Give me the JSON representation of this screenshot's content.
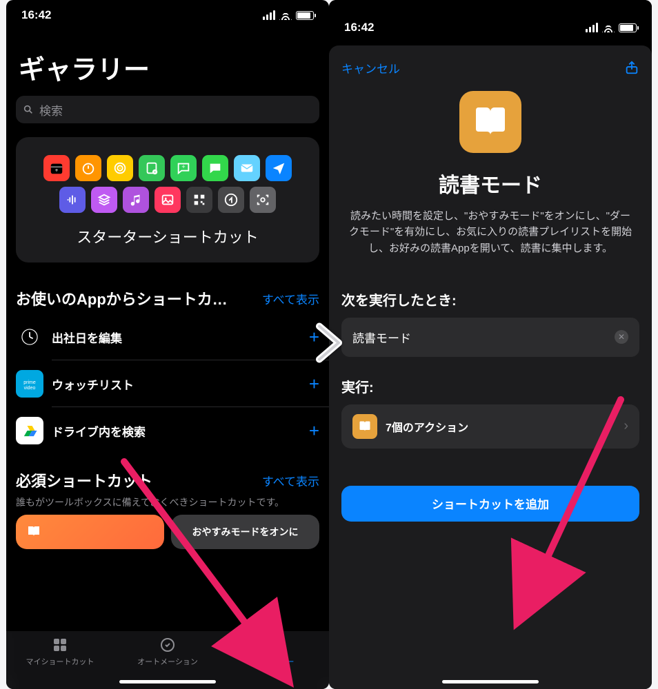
{
  "status": {
    "time": "16:42"
  },
  "left": {
    "title": "ギャラリー",
    "search_placeholder": "検索",
    "starter_card": {
      "title": "スターターショートカット",
      "tiles": [
        {
          "bg": "#ff3b30",
          "icon": "calendar-plus"
        },
        {
          "bg": "#ff9500",
          "icon": "timer"
        },
        {
          "bg": "#ffcc00",
          "icon": "airplay"
        },
        {
          "bg": "#34c759",
          "icon": "note-plus"
        },
        {
          "bg": "#30d158",
          "icon": "chat-plus"
        },
        {
          "bg": "#32d74b",
          "icon": "message"
        },
        {
          "bg": "#64d2ff",
          "icon": "mail"
        },
        {
          "bg": "#0a84ff",
          "icon": "send"
        },
        {
          "bg": "#5e5ce6",
          "icon": "waveform"
        },
        {
          "bg": "#bf5af2",
          "icon": "layers"
        },
        {
          "bg": "#af52de",
          "icon": "music-note"
        },
        {
          "bg": "#ff375f",
          "icon": "photo"
        },
        {
          "bg": "#3a3a3c",
          "icon": "qr"
        },
        {
          "bg": "#48484a",
          "icon": "share-arrow"
        },
        {
          "bg": "#636366",
          "icon": "scan"
        }
      ]
    },
    "section_apps": {
      "title": "お使いのAppからショートカ…",
      "see_all": "すべて表示",
      "items": [
        {
          "icon_bg": "#000",
          "icon": "clock",
          "label": "出社日を編集"
        },
        {
          "icon_bg": "#00a8e1",
          "icon": "prime-video",
          "label": "ウォッチリスト"
        },
        {
          "icon_bg": "#fff",
          "icon": "drive",
          "label": "ドライブ内を検索"
        }
      ]
    },
    "section_essential": {
      "title": "必須ショートカット",
      "see_all": "すべて表示",
      "subtitle": "誰もがツールボックスに備えておくべきショートカットです。",
      "peek_b_label": "おやすみモードをオンに"
    },
    "tabs": [
      {
        "label": "マイショートカット",
        "icon": "grid"
      },
      {
        "label": "オートメーション",
        "icon": "clock-check"
      },
      {
        "label": "ギャラリー",
        "icon": "stack"
      }
    ]
  },
  "right": {
    "cancel": "キャンセル",
    "hero": {
      "title": "読書モード",
      "description": "読みたい時間を設定し、\"おやすみモード\"をオンにし、\"ダークモード\"を有効にし、お気に入りの読書プレイリストを開始し、お好みの読書Appを開いて、読書に集中します。"
    },
    "when_label": "次を実行したとき:",
    "when_value": "読書モード",
    "do_label": "実行:",
    "actions_count": "7個のアクション",
    "add_button": "ショートカットを追加"
  }
}
